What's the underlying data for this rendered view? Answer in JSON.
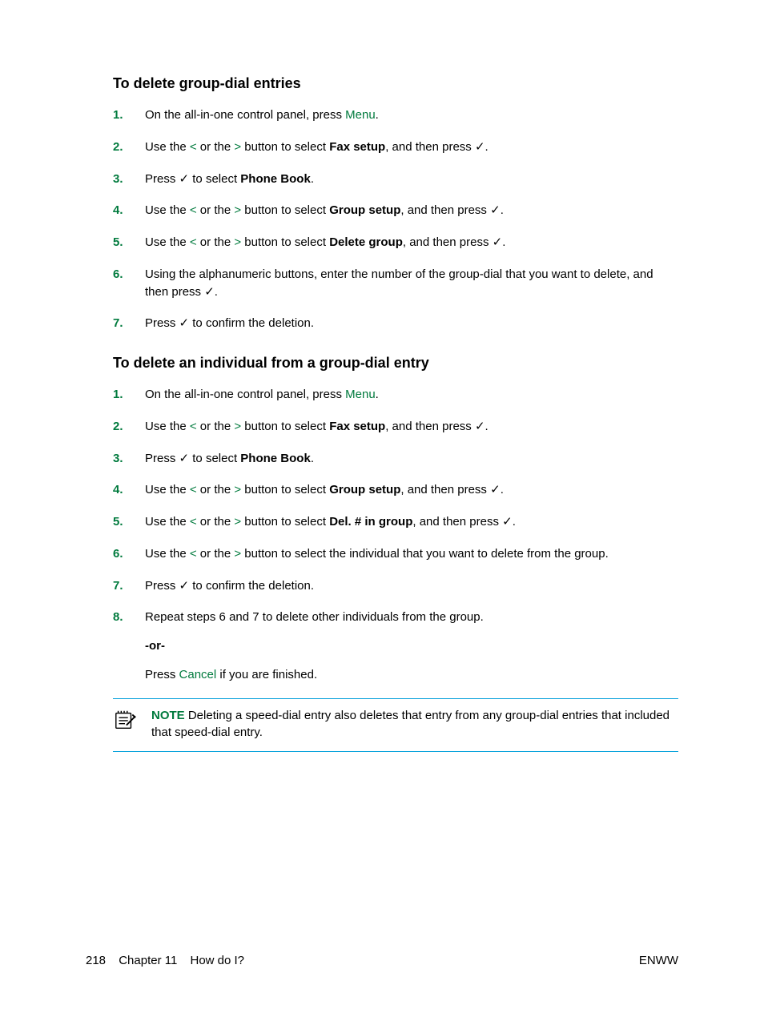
{
  "accent_color": "#007a3d",
  "rule_color": "#009fda",
  "section1": {
    "heading": "To delete group-dial entries",
    "steps": [
      {
        "n": "1.",
        "pre": "On the all-in-one control panel, press ",
        "menu": "Menu",
        "post": "."
      },
      {
        "n": "2.",
        "t1": "Use the ",
        "lt": "<",
        "t2": " or the ",
        "gt": ">",
        "t3": " button to select ",
        "bold": "Fax setup",
        "t4": ", and then press ",
        "check": "✓",
        "t5": "."
      },
      {
        "n": "3.",
        "t1": "Press ",
        "check": "✓",
        "t2": " to select ",
        "bold": "Phone Book",
        "t3": "."
      },
      {
        "n": "4.",
        "t1": "Use the ",
        "lt": "<",
        "t2": " or the ",
        "gt": ">",
        "t3": " button to select ",
        "bold": "Group setup",
        "t4": ", and then press ",
        "check": "✓",
        "t5": "."
      },
      {
        "n": "5.",
        "t1": "Use the ",
        "lt": "<",
        "t2": " or the ",
        "gt": ">",
        "t3": " button to select ",
        "bold": "Delete group",
        "t4": ", and then press ",
        "check": "✓",
        "t5": "."
      },
      {
        "n": "6.",
        "t1": "Using the alphanumeric buttons, enter the number of the group-dial that you want to delete, and then press ",
        "check": "✓",
        "t2": "."
      },
      {
        "n": "7.",
        "t1": "Press ",
        "check": "✓",
        "t2": " to confirm the deletion."
      }
    ]
  },
  "section2": {
    "heading": "To delete an individual from a group-dial entry",
    "steps": [
      {
        "n": "1.",
        "pre": "On the all-in-one control panel, press ",
        "menu": "Menu",
        "post": "."
      },
      {
        "n": "2.",
        "t1": "Use the ",
        "lt": "<",
        "t2": " or the ",
        "gt": ">",
        "t3": " button to select ",
        "bold": "Fax setup",
        "t4": ", and then press ",
        "check": "✓",
        "t5": "."
      },
      {
        "n": "3.",
        "t1": "Press ",
        "check": "✓",
        "t2": " to select ",
        "bold": "Phone Book",
        "t3": "."
      },
      {
        "n": "4.",
        "t1": "Use the ",
        "lt": "<",
        "t2": " or the ",
        "gt": ">",
        "t3": " button to select ",
        "bold": "Group setup",
        "t4": ", and then press ",
        "check": "✓",
        "t5": "."
      },
      {
        "n": "5.",
        "t1": "Use the ",
        "lt": "<",
        "t2": " or the ",
        "gt": ">",
        "t3": " button to select ",
        "bold": "Del. # in group",
        "t4": ", and then press ",
        "check": "✓",
        "t5": "."
      },
      {
        "n": "6.",
        "t1": "Use the ",
        "lt": "<",
        "t2": " or the ",
        "gt": ">",
        "t3": " button to select the individual that you want to delete from the group."
      },
      {
        "n": "7.",
        "t1": "Press ",
        "check": "✓",
        "t2": " to confirm the deletion."
      },
      {
        "n": "8.",
        "t1": "Repeat steps 6 and 7 to delete other individuals from the group.",
        "or": "-or-",
        "cancel_pre": "Press ",
        "cancel": "Cancel",
        "cancel_post": " if you are finished."
      }
    ]
  },
  "note": {
    "label": "NOTE",
    "text": "   Deleting a speed-dial entry also deletes that entry from any group-dial entries that included that speed-dial entry."
  },
  "footer": {
    "page": "218",
    "chapter": "Chapter 11",
    "title": "How do I?",
    "right": "ENWW"
  }
}
